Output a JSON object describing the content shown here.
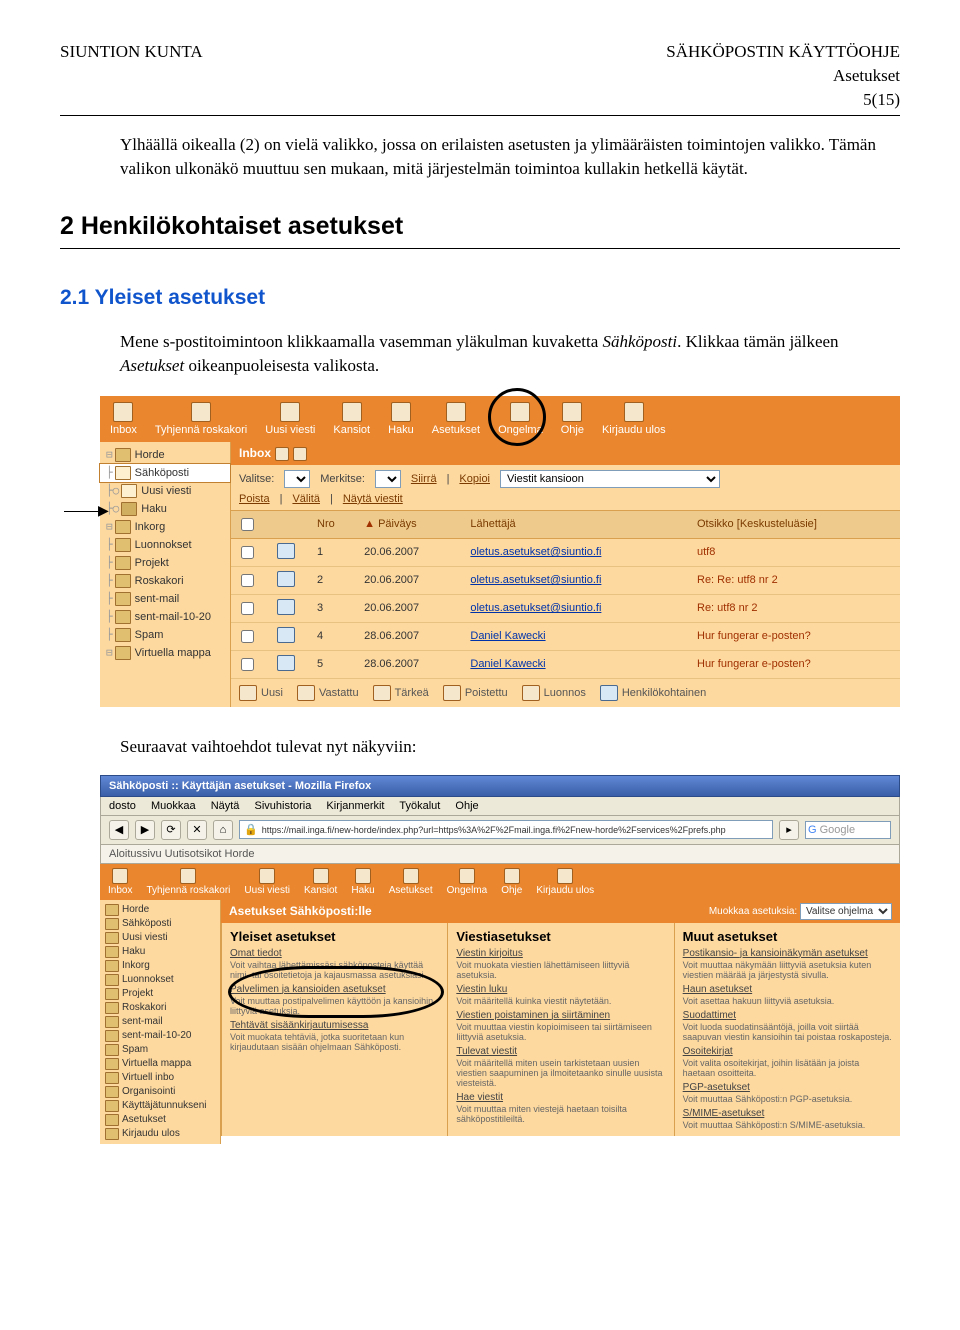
{
  "header": {
    "left": "SIUNTION KUNTA",
    "right1": "SÄHKÖPOSTIN KÄYTTÖOHJE",
    "right2": "Asetukset",
    "right3": "5(15)"
  },
  "intro": "Ylhäällä oikealla (2) on vielä valikko, jossa on erilaisten asetusten ja ylimääräisten toimintojen valikko. Tämän valikon ulkonäkö muuttuu sen mukaan, mitä järjestelmän toimintoa kullakin hetkellä käytät.",
  "h1": "2 Henkilökohtaiset asetukset",
  "h2": "2.1 Yleiset asetukset",
  "para2a": "Mene s-postitoimintoon klikkaamalla vasemman yläkulman kuvaketta ",
  "para2b": "Sähköposti",
  "para2c": ". Klikkaa tämän jälkeen ",
  "para2d": "Asetukset",
  "para2e": " oikeanpuoleisesta valikosta.",
  "tb": [
    "Inbox",
    "Tyhjennä roskakori",
    "Uusi viesti",
    "Kansiot",
    "Haku",
    "Asetukset",
    "Ongelma",
    "Ohje",
    "Kirjaudu ulos"
  ],
  "sb": [
    "Horde",
    "Sähköposti",
    "Uusi viesti",
    "Haku",
    "Inkorg",
    "Luonnokset",
    "Projekt",
    "Roskakori",
    "sent-mail",
    "sent-mail-10-20",
    "Spam",
    "Virtuella mappa"
  ],
  "crumb": "Inbox",
  "selects": {
    "valitse": "Valitse:",
    "merkitse": "Merkitse:",
    "siirra": "Siirrä",
    "kopioi": "Kopioi",
    "viestit": "Viestit kansioon"
  },
  "actions": [
    "Poista",
    "Välitä",
    "Näytä viestit"
  ],
  "th": {
    "nro": "Nro",
    "paiv": "Päiväys",
    "lah": "Lähettäjä",
    "ots": "Otsikko",
    "kes": "Keskusteluäsie"
  },
  "rows": [
    {
      "n": "1",
      "d": "20.06.2007",
      "s": "oletus.asetukset@siuntio.fi",
      "t": "utf8"
    },
    {
      "n": "2",
      "d": "20.06.2007",
      "s": "oletus.asetukset@siuntio.fi",
      "t": "Re: Re: utf8 nr 2"
    },
    {
      "n": "3",
      "d": "20.06.2007",
      "s": "oletus.asetukset@siuntio.fi",
      "t": "Re: utf8 nr 2"
    },
    {
      "n": "4",
      "d": "28.06.2007",
      "s": "Daniel Kawecki",
      "t": "Hur fungerar e-posten?"
    },
    {
      "n": "5",
      "d": "28.06.2007",
      "s": "Daniel Kawecki",
      "t": "Hur fungerar e-posten?"
    }
  ],
  "legend": [
    "Uusi",
    "Vastattu",
    "Tärkeä",
    "Poistettu",
    "Luonnos",
    "Henkilökohtainen"
  ],
  "caption": "Seuraavat vaihtoehdot tulevat nyt näkyviin:",
  "ff": {
    "title": "Sähköposti :: Käyttäjän asetukset - Mozilla Firefox",
    "menu": [
      "dosto",
      "Muokkaa",
      "Näytä",
      "Sivuhistoria",
      "Kirjanmerkit",
      "Työkalut",
      "Ohje"
    ],
    "url": "https://mail.inga.fi/new-horde/index.php?url=https%3A%2F%2Fmail.inga.fi%2Fnew-horde%2Fservices%2Fprefs.php",
    "search": "Google",
    "bm": "Aloitussivu   Uutisotsikot   Horde",
    "tb2": [
      "Inbox",
      "Tyhjennä roskakori",
      "Uusi viesti",
      "Kansiot",
      "Haku",
      "Asetukset",
      "Ongelma",
      "Ohje",
      "Kirjaudu ulos"
    ],
    "apptitle": "Asetukset Sähköposti:lle",
    "modlabel": "Muokkaa asetuksia:",
    "modval": "Valitse ohjelma",
    "sb2": [
      "Horde",
      "Sähköposti",
      "Uusi viesti",
      "Haku",
      "Inkorg",
      "Luonnokset",
      "Projekt",
      "Roskakori",
      "sent-mail",
      "sent-mail-10-20",
      "Spam",
      "Virtuella mappa",
      "Virtuell inbo",
      "Organisointi",
      "Käyttäjätunnukseni",
      "Asetukset",
      "Kirjaudu ulos"
    ],
    "col1": {
      "h": "Yleiset asetukset",
      "items": [
        {
          "l": "Omat tiedot",
          "d": "Voit vaihtaa lähettämissäsi sähköposteja käyttää nimi- tai osoitetietoja ja kajausmassa asetuksiasi."
        },
        {
          "l": "Palvelimen ja kansioiden asetukset",
          "d": "Voit muuttaa postipalvelimen käyttöön ja kansioihin liittyviä asetuksia."
        },
        {
          "l": "Tehtävät sisäänkirjautumisessa",
          "d": "Voit muokata tehtäviä, jotka suoritetaan kun kirjaudutaan sisään ohjelmaan Sähköposti."
        }
      ]
    },
    "col2": {
      "h": "Viestiasetukset",
      "items": [
        {
          "l": "Viestin kirjoitus",
          "d": "Voit muokata viestien lähettämiseen liittyviä asetuksia."
        },
        {
          "l": "Viestin luku",
          "d": "Voit määritellä kuinka viestit näytetään."
        },
        {
          "l": "Viestien poistaminen ja siirtäminen",
          "d": "Voit muuttaa viestin kopioimiseen tai siirtämiseen liittyviä asetuksia."
        },
        {
          "l": "Tulevat viestit",
          "d": "Voit määritellä miten usein tarkistetaan uusien viestien saapuminen ja ilmoitetaanko sinulle uusista viesteistä."
        },
        {
          "l": "Hae viestit",
          "d": "Voit muuttaa miten viestejä haetaan toisilta sähköpostitileiltä."
        }
      ]
    },
    "col3": {
      "h": "Muut asetukset",
      "items": [
        {
          "l": "Postikansio- ja kansioinäkymän asetukset",
          "d": "Voit muuttaa näkymään liittyviä asetuksia kuten viestien määrää ja järjestystä sivulla."
        },
        {
          "l": "Haun asetukset",
          "d": "Voit asettaa hakuun liittyviä asetuksia."
        },
        {
          "l": "Suodattimet",
          "d": "Voit luoda suodatinsääntöjä, joilla voit siirtää saapuvan viestin kansioihin tai poistaa roskaposteja."
        },
        {
          "l": "Osoitekirjat",
          "d": "Voit valita osoitekirjat, joihin lisätään ja joista haetaan osoitteita."
        },
        {
          "l": "PGP-asetukset",
          "d": "Voit muuttaa Sähköposti:n PGP-asetuksia."
        },
        {
          "l": "S/MIME-asetukset",
          "d": "Voit muuttaa Sähköposti:n S/MIME-asetuksia."
        }
      ]
    }
  }
}
